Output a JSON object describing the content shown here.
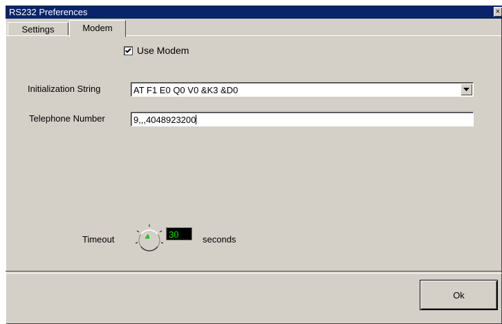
{
  "window": {
    "title": "RS232 Preferences",
    "close_glyph": "×"
  },
  "tabs": [
    {
      "label": "Settings",
      "active": false
    },
    {
      "label": "Modem",
      "active": true
    }
  ],
  "modem": {
    "use_modem_label": "Use Modem",
    "use_modem_checked": true,
    "init_label": "Initialization String",
    "init_value": "AT F1 E0 Q0 V0 &K3 &D0",
    "phone_label": "Telephone Number",
    "phone_value": "9,,,4048923200",
    "timeout_label": "Timeout",
    "timeout_value": "30",
    "timeout_unit": "seconds"
  },
  "ok_label": "Ok",
  "colors": {
    "title_bar": "#0a246a",
    "face": "#d4d0c8",
    "display_text": "#00e000"
  }
}
